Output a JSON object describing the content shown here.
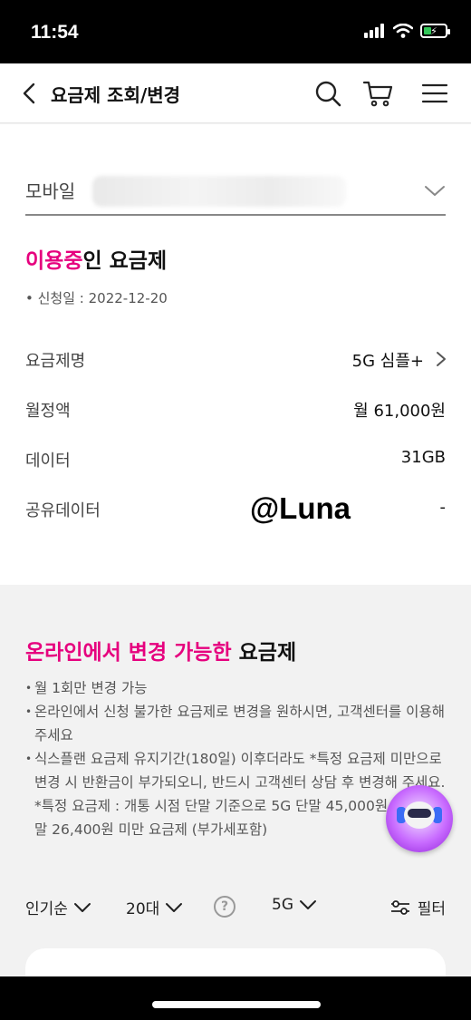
{
  "status_bar": {
    "time": "11:54",
    "battery_level_percent": 40,
    "battery_charging": true,
    "icons": [
      "signal-icon",
      "wifi-icon",
      "battery-charging-icon"
    ]
  },
  "header": {
    "title": "요금제 조회/변경",
    "icons": [
      "back-chevron-icon",
      "search-icon",
      "cart-icon",
      "menu-icon"
    ]
  },
  "line_selector": {
    "label": "모바일",
    "value_blurred": true
  },
  "current_plan": {
    "title_highlight": "이용중",
    "title_rest": "인 요금제",
    "apply_date": "• 신청일 : 2022-12-20",
    "rows": [
      {
        "label": "요금제명",
        "value": "5G 심플+"
      },
      {
        "label": "월정액",
        "value": "월 61,000원"
      },
      {
        "label": "데이터",
        "value": "31GB"
      },
      {
        "label": "공유데이터",
        "value": "-"
      }
    ]
  },
  "watermark": "@Luna",
  "online_change": {
    "title_highlight": "온라인에서 변경 가능한",
    "title_rest": " 요금제",
    "notes": [
      "월 1회만 변경 가능",
      "온라인에서 신청 불가한 요금제로 변경을 원하시면, 고객센터를 이용해 주세요",
      "식스플랜 요금제 유지기간(180일) 이후더라도 *특정 요금제 미만으로 변경 시 반환금이 부가되오니, 반드시 고객센터 상담 후 변경해 주세요."
    ],
    "sub_note": "*특정 요금제 : 개통 시점 단말 기준으로 5G 단말 45,000원, LTE 단말 26,400원 미만 요금제 (부가세포함)"
  },
  "filters": {
    "sort": "인기순",
    "age": "20대",
    "network": "5G",
    "filter_button": "필터"
  },
  "colors": {
    "accent_pink": "#e6007e",
    "chatbot_purple": "#b14cf0"
  }
}
